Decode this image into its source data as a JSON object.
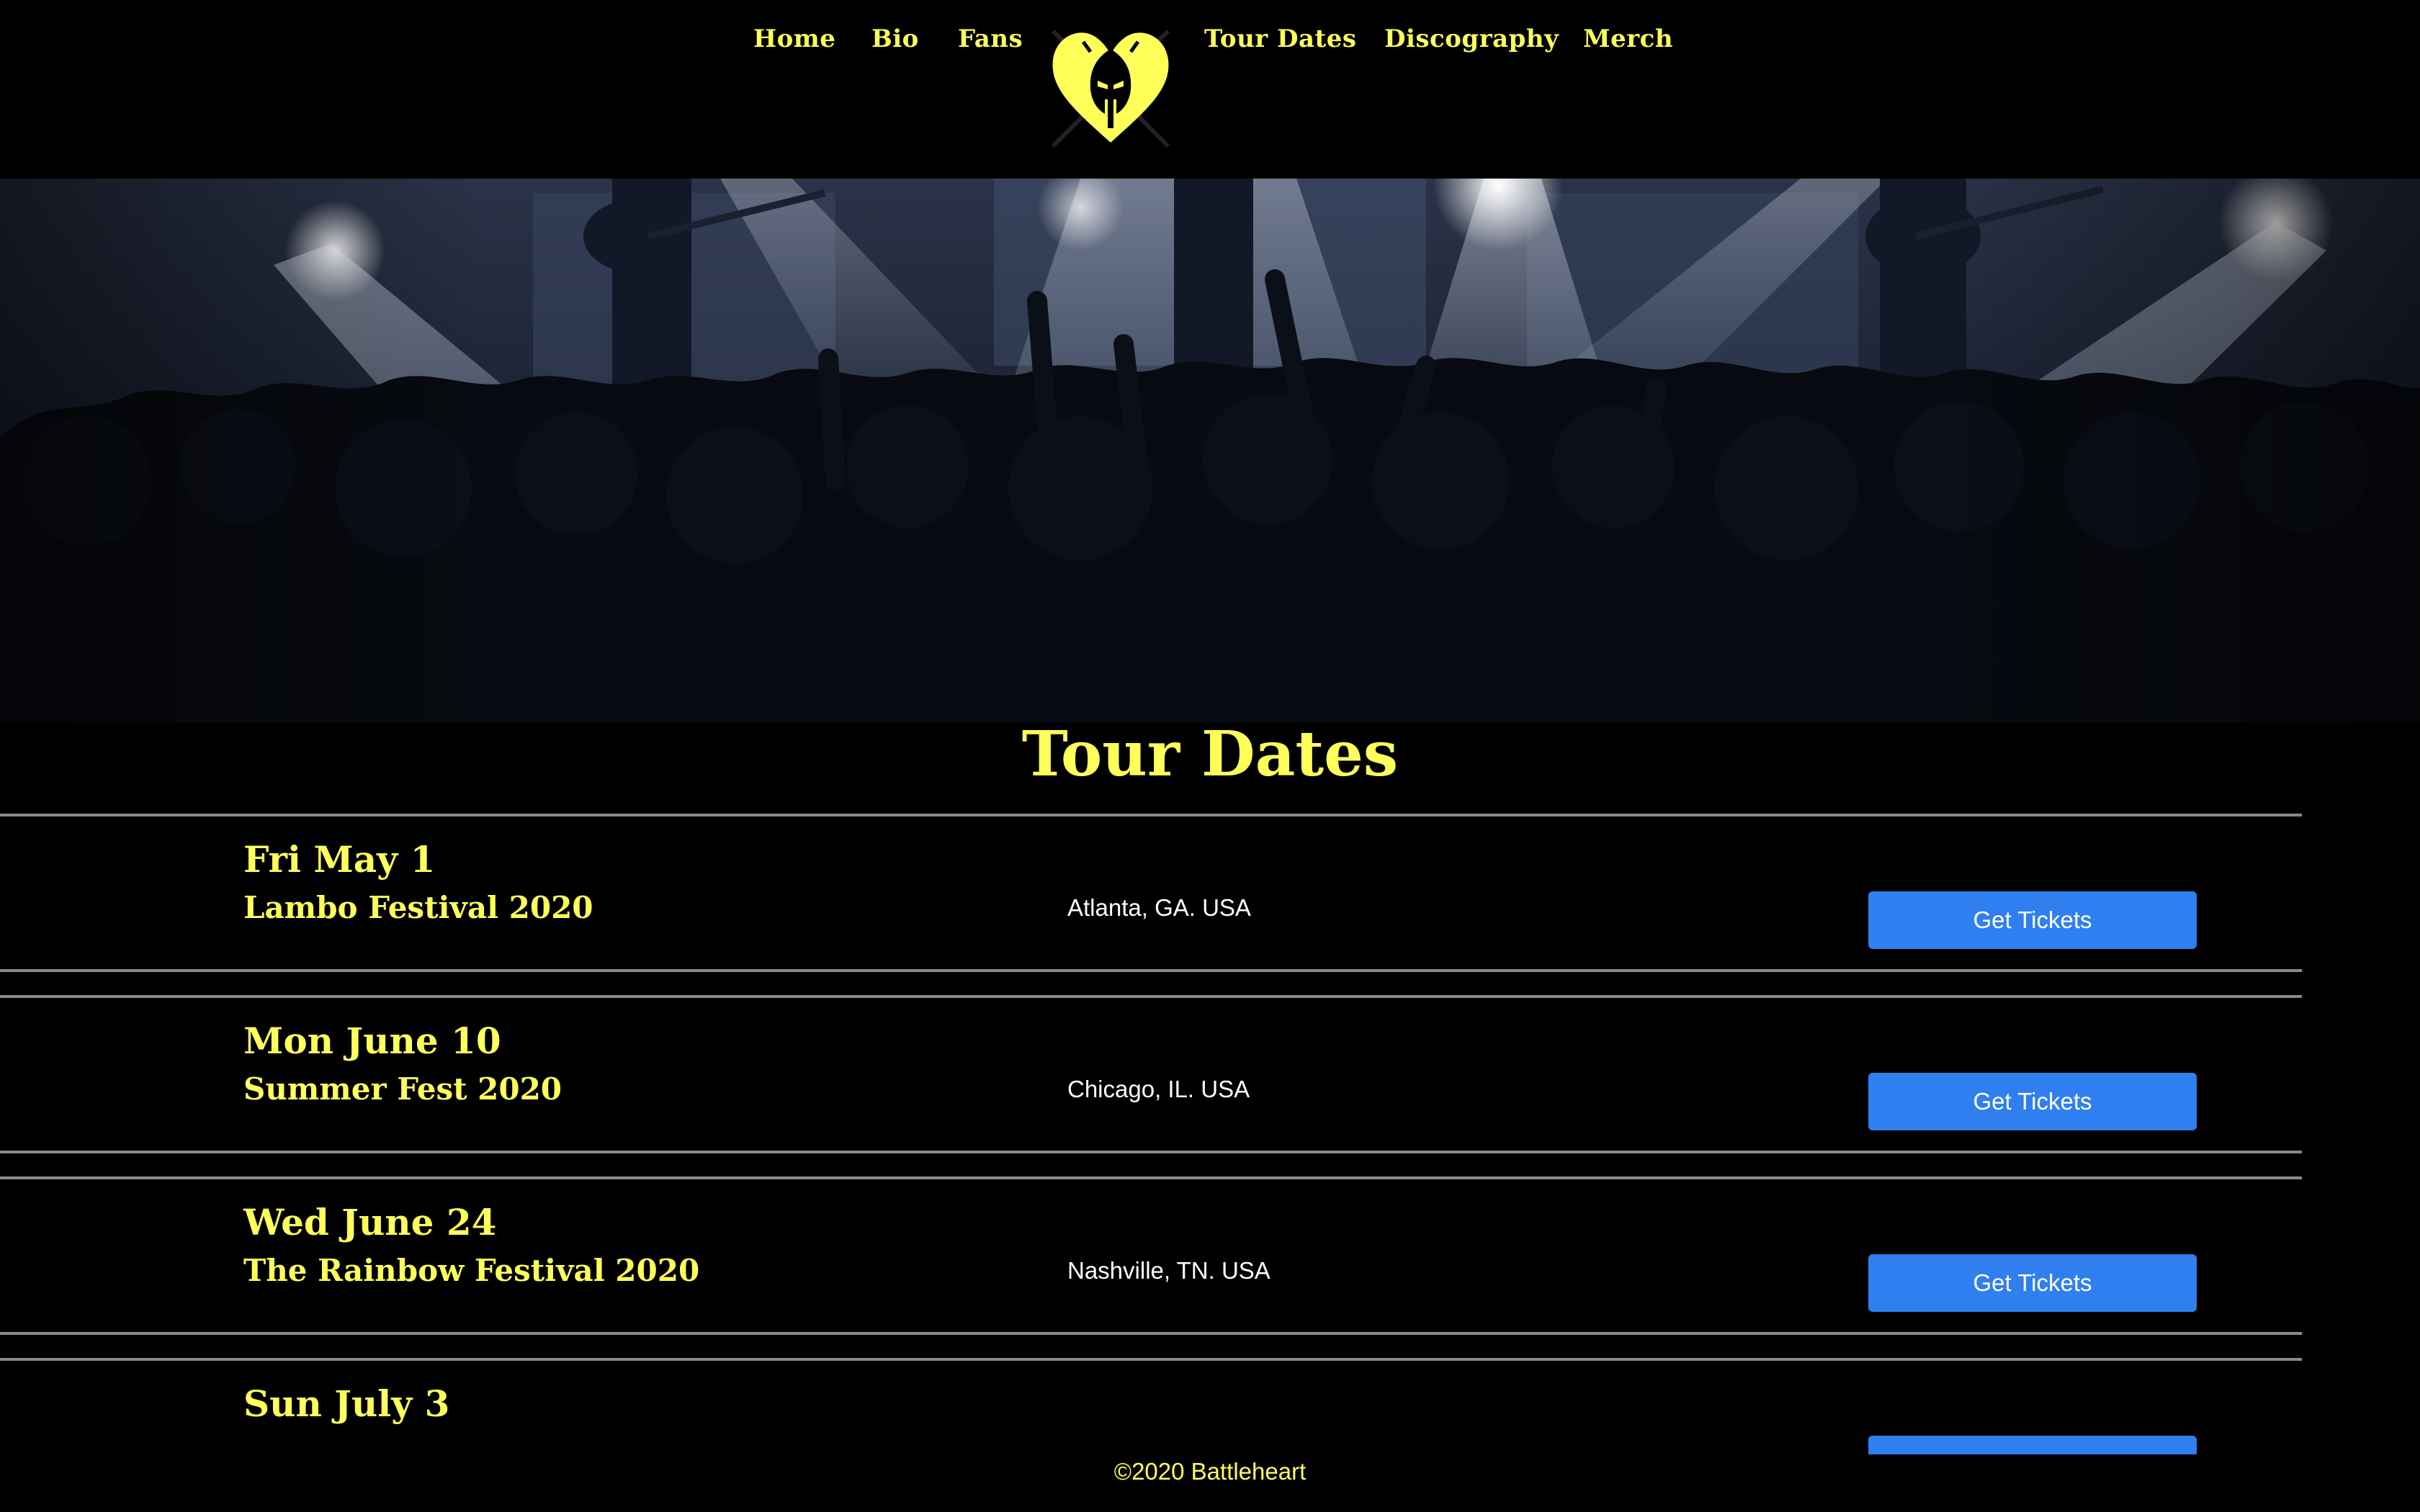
{
  "nav": {
    "items": [
      {
        "label": "Home"
      },
      {
        "label": "Bio"
      },
      {
        "label": "Fans"
      },
      {
        "label": "Tour Dates"
      },
      {
        "label": "Discography"
      },
      {
        "label": "Merch"
      }
    ],
    "logo_icon": "battleheart-spartan-heart-logo"
  },
  "hero": {
    "image": "concert-crowd-stage-lights"
  },
  "tour": {
    "title": "Tour Dates",
    "rows": [
      {
        "date": "Fri May 1",
        "event": "Lambo Festival 2020",
        "location": "Atlanta, GA. USA",
        "button": "Get Tickets"
      },
      {
        "date": "Mon June 10",
        "event": "Summer Fest 2020",
        "location": "Chicago, IL. USA",
        "button": "Get Tickets"
      },
      {
        "date": "Wed June 24",
        "event": "The Rainbow Festival 2020",
        "location": "Nashville, TN. USA",
        "button": "Get Tickets"
      },
      {
        "date": "Sun July 3",
        "event": "",
        "location": "",
        "button": ""
      }
    ]
  },
  "footer": {
    "text": "©2020 Battleheart"
  },
  "colors": {
    "accent": "#ffff5a",
    "button": "#2f7ff0",
    "background": "#000000",
    "divider": "#8a8a8a"
  }
}
